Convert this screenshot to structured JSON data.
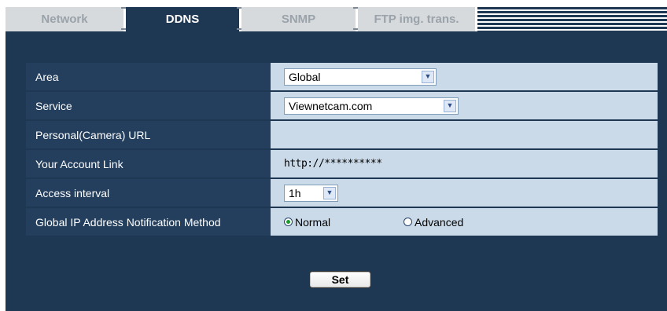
{
  "tabs": [
    {
      "label": "Network",
      "active": false
    },
    {
      "label": "DDNS",
      "active": true
    },
    {
      "label": "SNMP",
      "active": false
    },
    {
      "label": "FTP img. trans.",
      "active": false
    }
  ],
  "form": {
    "area": {
      "label": "Area",
      "value": "Global"
    },
    "service": {
      "label": "Service",
      "value": "Viewnetcam.com"
    },
    "personal_url": {
      "label": "Personal(Camera) URL",
      "value": ""
    },
    "account_link": {
      "label": "Your Account Link",
      "value": "http://**********"
    },
    "access_interval": {
      "label": "Access interval",
      "value": "1h"
    },
    "notification": {
      "label": "Global IP Address Notification Method",
      "options": [
        {
          "label": "Normal",
          "selected": true
        },
        {
          "label": "Advanced",
          "selected": false
        }
      ]
    }
  },
  "set_button": "Set",
  "colors": {
    "panel": "#1e3753",
    "value_bg": "#cbdae9",
    "tab_inactive": "#d7dadd",
    "radio_selected": "#1a9a2a"
  }
}
